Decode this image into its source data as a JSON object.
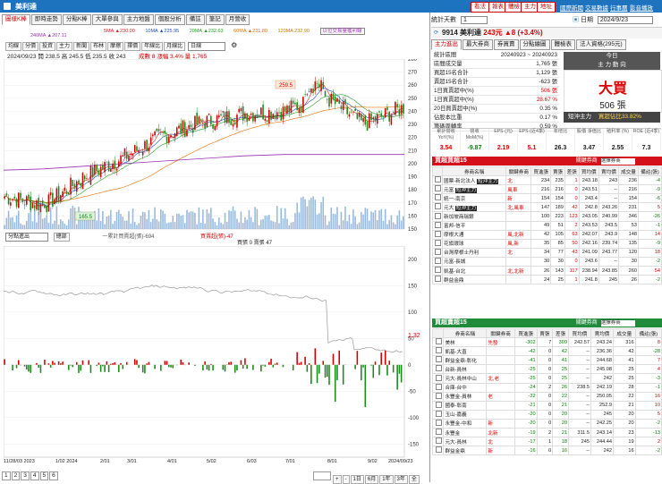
{
  "title": "美利達",
  "header_buttons": [
    "看法",
    "報表",
    "體檢",
    "主力",
    "地址"
  ],
  "header_links": [
    "國際新聞",
    "交易數據",
    "行事曆",
    "影音播放"
  ],
  "tabs": [
    "圖樣K棒",
    "即時走勢",
    "分點K棒",
    "大單參與",
    "主力地盤",
    "個股分析",
    "備註",
    "筆記",
    "月營收"
  ],
  "ma_legend": [
    "5MA ▲230.00",
    "10MA ▲225.95",
    "20MA ▲232.63",
    "60MA ▲231.80",
    "120MA 232.90",
    "240MA ▲207.11",
    "以位交易量獲利線"
  ],
  "chart_tools": [
    "均線",
    "分價",
    "投資",
    "主力",
    "新聞",
    "布林",
    "摩擦",
    "擇價",
    "年線比",
    "月線比"
  ],
  "period_select": "日線",
  "price_info": "2024/09/23  開 238.5  高 245.5  低 235.5  收 243",
  "vol_info": "成數 8  漲幅 3.4%  量 1,765",
  "annot_high": "259.5",
  "annot_low": "165.5",
  "price_axis": [
    "280",
    "270",
    "260",
    "250",
    "240",
    "230",
    "220",
    "210",
    "200",
    "190",
    "180",
    "170",
    "160",
    "150"
  ],
  "lower_panel": {
    "select_label": "分點進出",
    "select_btn": "總部",
    "legend_cum": "一累計買賣超(張)-694",
    "legend_bs": "買賣超(張)-47",
    "legend_buy": "買張 0  賣張 47",
    "value_label": "1.32",
    "axis": [
      "200",
      "150",
      "100",
      "50",
      "0",
      "-50",
      "-100",
      "-150"
    ]
  },
  "x_axis": [
    "11/28/03 2023",
    "1/02 2024",
    "2/01",
    "3/01",
    "4/01",
    "5/02",
    "6/03",
    "7/01",
    "8/01",
    "9/02",
    "2024/09/23"
  ],
  "pager": [
    "1",
    "2",
    "3",
    "4",
    "5",
    "6"
  ],
  "pager_periods": [
    "1日",
    "6月",
    "1年",
    "3年",
    "全"
  ],
  "right": {
    "stat_label": "統計天數",
    "stat_days": "1",
    "date_label": "日期",
    "date": "2024/9/23",
    "stock": "9914 美利達",
    "stock_price": "243元",
    "stock_chg": "▲8 (+3.4%)",
    "tabs": [
      "主力進出",
      "最大券商",
      "券買賣",
      "分點繪圖",
      "體檢表",
      "法人資格(295元)"
    ],
    "stats": [
      [
        "統計區間",
        "20240923 ~ 20240923"
      ],
      [
        "區間成交量",
        "1,765 張"
      ],
      [
        "買超15名合計",
        "1,129 張"
      ],
      [
        "賣超15名合計",
        "-623 張"
      ],
      [
        "1日買賣超中(%)",
        "506 張"
      ],
      [
        "1日買賣超中(%)",
        "28.67 %"
      ],
      [
        "20日買賣超中(%)",
        "0.35 %"
      ],
      [
        "佔股本比重",
        "0.17 %"
      ],
      [
        "籌碼周轉率",
        "0.59 %"
      ]
    ],
    "today_label": "今日",
    "force_label": "主 力 動 向",
    "big_text": "大買",
    "big_num": "506 張",
    "short_label": "短沖主力",
    "short_val": "買超佔比33.82%",
    "metrics_header": [
      "累計營收 YoY(%)",
      "營收 MoM(%)",
      "EPS (元)",
      "EPS (近4季)",
      "年增比",
      "股價 淨值比",
      "殖利率 (%)",
      "ROE (近4季)"
    ],
    "metrics_values": [
      "3.54",
      "-9.87",
      "2.19",
      "5.1",
      "26.3",
      "3.47",
      "2.55",
      "7.3"
    ],
    "buy_title": "買超買超15",
    "sell_title": "買超賣超15",
    "hint": "關鍵券商",
    "hint_select": "選擇券商",
    "table_header": [
      "",
      "券商名稱",
      "關鍵券商",
      "買進張",
      "賣張",
      "差張",
      "買均價",
      "賣均價",
      "成交量",
      "備註(張)"
    ],
    "buy_rows": [
      [
        "",
        "國票-新北法人 短沖主力",
        "北",
        "234",
        "235",
        "1",
        "243.18",
        "243",
        "236",
        "-4"
      ],
      [
        "",
        "元富 短沖主力",
        "風車",
        "216",
        "216",
        "0",
        "243.51",
        "--",
        "216",
        "-9"
      ],
      [
        "",
        "統一-南京",
        "新",
        "154",
        "154",
        "0",
        "243.4",
        "--",
        "154",
        "-6"
      ],
      [
        "",
        "元大 短沖主力",
        "北,風車",
        "147",
        "189",
        "42",
        "242.8",
        "243.26",
        "231",
        "5"
      ],
      [
        "",
        "新加坡商瑞銀",
        "",
        "100",
        "223",
        "123",
        "243.05",
        "240.99",
        "346",
        "-26"
      ],
      [
        "",
        "富邦-信平",
        "",
        "49",
        "51",
        "2",
        "243.53",
        "243.5",
        "53",
        "-1"
      ],
      [
        "",
        "摩根大通",
        "風,北新",
        "42",
        "105",
        "63",
        "242.07",
        "243.9",
        "148",
        "14"
      ],
      [
        "",
        "花旗環球",
        "風,新",
        "35",
        "85",
        "50",
        "242.16",
        "239.74",
        "135",
        "-9"
      ],
      [
        "",
        "台灣摩根士丹利",
        "北",
        "34",
        "77",
        "43",
        "241.09",
        "243.77",
        "120",
        "18"
      ],
      [
        "",
        "元富-長城",
        "",
        "30",
        "30",
        "0",
        "243.6",
        "--",
        "30",
        "-2"
      ],
      [
        "",
        "凱基-台北",
        "北,北新",
        "26",
        "143",
        "117",
        "238.94",
        "243.85",
        "260",
        "54"
      ],
      [
        "",
        "群益金鼎",
        "",
        "24",
        "25",
        "1",
        "241.8",
        "245",
        "26",
        "-2"
      ]
    ],
    "sell_rows": [
      [
        "",
        "美林",
        "先發",
        "-302",
        "7",
        "309",
        "242.57",
        "243.24",
        "316",
        "8"
      ],
      [
        "",
        "凱基-大直",
        "",
        "-42",
        "0",
        "42",
        "--",
        "236.36",
        "42",
        "-28"
      ],
      [
        "",
        "群益金鼎-彰化",
        "",
        "-41",
        "0",
        "41",
        "--",
        "244.68",
        "41",
        "7"
      ],
      [
        "",
        "台新-員林",
        "",
        "-25",
        "0",
        "25",
        "--",
        "245.08",
        "25",
        "4"
      ],
      [
        "",
        "元大-員林中山",
        "北,老",
        "-25",
        "0",
        "25",
        "--",
        "242",
        "25",
        "-3"
      ],
      [
        "",
        "合庫-台中",
        "",
        "-24",
        "2",
        "26",
        "238.5",
        "242.19",
        "28",
        "-1"
      ],
      [
        "",
        "永豐金-員林",
        "老",
        "-22",
        "0",
        "22",
        "--",
        "250.05",
        "22",
        "16"
      ],
      [
        "",
        "國泰-彰南",
        "",
        "-21",
        "0",
        "21",
        "--",
        "252.9",
        "21",
        "10"
      ],
      [
        "",
        "玉山-嘉義",
        "",
        "-20",
        "0",
        "20",
        "--",
        "245",
        "20",
        "5"
      ],
      [
        "",
        "永豐金-中和",
        "新",
        "-20",
        "0",
        "20",
        "--",
        "242.25",
        "20",
        "-2"
      ],
      [
        "",
        "永豐金",
        "北新",
        "-19",
        "2",
        "21",
        "311.5",
        "243.14",
        "23",
        "-13"
      ],
      [
        "",
        "元大-員林",
        "北",
        "-17",
        "1",
        "18",
        "245",
        "244.44",
        "19",
        "2"
      ],
      [
        "",
        "群益金鼎",
        "新",
        "-16",
        "0",
        "16",
        "--",
        "242",
        "16",
        "-2"
      ]
    ]
  },
  "colors": {
    "up": "#d00000",
    "down": "#1a8a1a",
    "brand": "#1e73be",
    "buy_hdr": "#d4101a",
    "sell_hdr": "#1f8a3a"
  },
  "chart_data": [
    {
      "type": "line",
      "title": "美利達 日線",
      "x": [
        "11/28",
        "1/02",
        "2/01",
        "3/01",
        "4/01",
        "5/02",
        "6/03",
        "7/01",
        "8/01",
        "9/02",
        "9/23"
      ],
      "series": [
        {
          "name": "收盤",
          "values": [
            175,
            168,
            190,
            205,
            222,
            232,
            238,
            240,
            252,
            230,
            243
          ]
        },
        {
          "name": "240MA",
          "values": [
            195,
            196,
            198,
            200,
            202,
            204,
            206,
            207,
            207,
            207,
            207
          ]
        }
      ],
      "ylim": [
        150,
        280
      ]
    },
    {
      "type": "bar",
      "title": "分點進出",
      "series": [
        {
          "name": "買賣超(張)",
          "values": [
            12,
            -20,
            8,
            -15,
            30,
            -40,
            55,
            -30,
            -70,
            210,
            -80,
            -47
          ]
        }
      ],
      "ylim": [
        -150,
        200
      ]
    }
  ]
}
